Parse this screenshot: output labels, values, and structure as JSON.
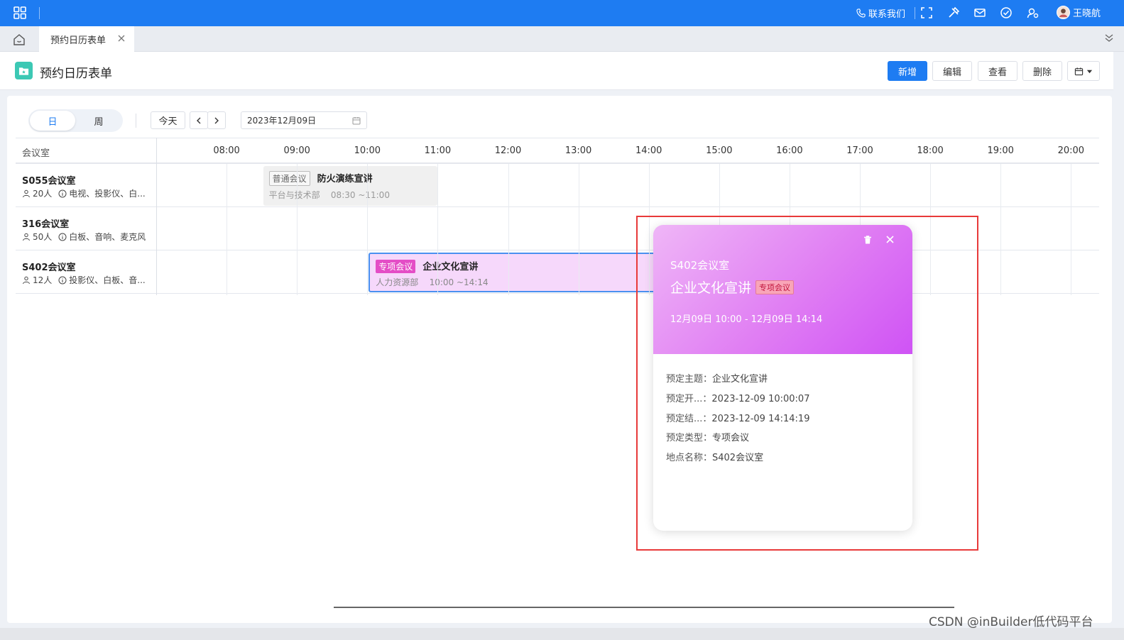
{
  "topbar": {
    "contact_label": "联系我们",
    "user_name": "王晓航"
  },
  "tabs": [
    {
      "label": "预约日历表单"
    }
  ],
  "header": {
    "title": "预约日历表单",
    "buttons": [
      "新增",
      "编辑",
      "查看",
      "删除"
    ]
  },
  "view_toggle": {
    "day": "日",
    "week": "周",
    "active": "日"
  },
  "nav": {
    "today": "今天",
    "prev": "‹",
    "next": "›",
    "date": "2023年12月09日"
  },
  "schedule": {
    "room_header": "会议室",
    "hours": [
      "08:00",
      "09:00",
      "10:00",
      "11:00",
      "12:00",
      "13:00",
      "14:00",
      "15:00",
      "16:00",
      "17:00",
      "18:00",
      "19:00",
      "20:00"
    ],
    "rooms": [
      {
        "name": "S055会议室",
        "capacity": "20人",
        "equipment": "电视、投影仪、白..."
      },
      {
        "name": "316会议室",
        "capacity": "50人",
        "equipment": "白板、音响、麦克风"
      },
      {
        "name": "S402会议室",
        "capacity": "12人",
        "equipment": "投影仪、白板、音..."
      }
    ],
    "events": [
      {
        "room": "S055会议室",
        "tag": "普通会议",
        "title": "防火演练宣讲",
        "dept": "平台与技术部",
        "time": "08:30 ~11:00",
        "start": "08:30",
        "end": "11:00"
      },
      {
        "room": "S402会议室",
        "tag": "专项会议",
        "title": "企业文化宣讲",
        "dept": "人力资源部",
        "time": "10:00 ~14:14",
        "start": "10:00",
        "end": "14:14"
      }
    ]
  },
  "popup": {
    "room": "S402会议室",
    "title": "企业文化宣讲",
    "tag": "专项会议",
    "time_range": "12月09日 10:00  -  12月09日 14:14",
    "details": [
      {
        "key": "预定主题：",
        "value": "企业文化宣讲"
      },
      {
        "key": "预定开...：",
        "value": "2023-12-09 10:00:07"
      },
      {
        "key": "预定结...：",
        "value": "2023-12-09 14:14:19"
      },
      {
        "key": "预定类型：",
        "value": "专项会议"
      },
      {
        "key": "地点名称：",
        "value": "S402会议室"
      }
    ]
  },
  "watermark": "CSDN @inBuilder低代码平台"
}
